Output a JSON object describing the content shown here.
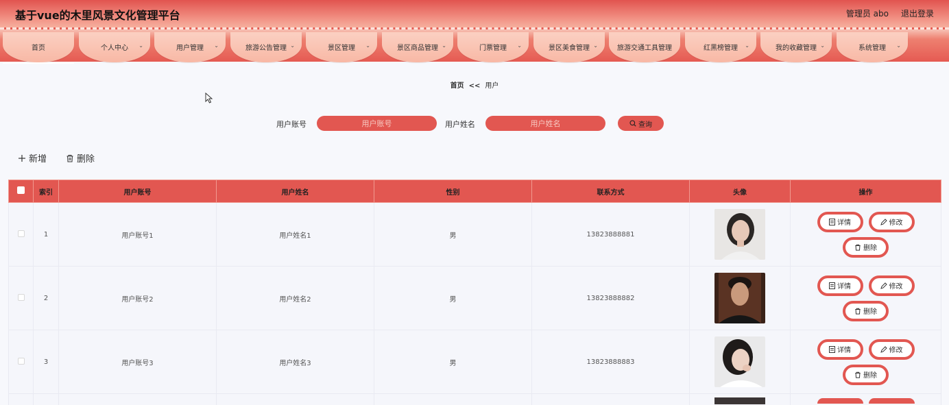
{
  "header": {
    "title": "基于vue的木里风景文化管理平台",
    "user": "管理员 abo",
    "logout": "退出登录"
  },
  "nav": [
    "首页",
    "个人中心",
    "用户管理",
    "旅游公告管理",
    "景区管理",
    "景区商品管理",
    "门票管理",
    "景区美食管理",
    "旅游交通工具管理",
    "红黑榜管理",
    "我的收藏管理",
    "系统管理"
  ],
  "breadcrumb": {
    "home": "首页",
    "sep": "<<",
    "current": "用户"
  },
  "search": {
    "account_label": "用户账号",
    "account_placeholder": "用户账号",
    "name_label": "用户姓名",
    "name_placeholder": "用户姓名",
    "button": "查询"
  },
  "actions": {
    "add": "新增",
    "delete": "删除"
  },
  "table": {
    "headers": [
      "索引",
      "用户账号",
      "用户姓名",
      "性别",
      "联系方式",
      "头像",
      "操作"
    ],
    "rows": [
      {
        "index": "1",
        "account": "用户账号1",
        "name": "用户姓名1",
        "gender": "男",
        "phone": "13823888881"
      },
      {
        "index": "2",
        "account": "用户账号2",
        "name": "用户姓名2",
        "gender": "男",
        "phone": "13823888882"
      },
      {
        "index": "3",
        "account": "用户账号3",
        "name": "用户姓名3",
        "gender": "男",
        "phone": "13823888883"
      }
    ],
    "ops": {
      "detail": "详情",
      "edit": "修改",
      "delete": "删除"
    }
  },
  "colors": {
    "accent": "#e25751",
    "header_top": "#e1544f",
    "tab": "#f8b8a5"
  }
}
